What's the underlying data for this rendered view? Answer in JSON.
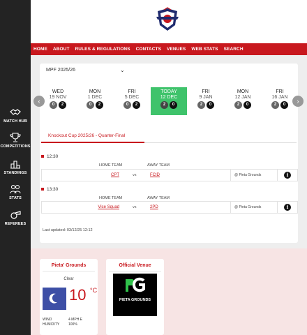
{
  "sidebar": {
    "items": [
      {
        "label": "MATCH HUB",
        "icon": "handshake-icon"
      },
      {
        "label": "COMPETITIONS",
        "icon": "trophy-icon"
      },
      {
        "label": "STANDINGS",
        "icon": "standings-icon"
      },
      {
        "label": "STATS",
        "icon": "stats-icon"
      },
      {
        "label": "REFEREES",
        "icon": "whistle-icon"
      }
    ]
  },
  "nav": {
    "items": [
      "HOME",
      "ABOUT",
      "RULES & REGULATIONS",
      "CONTACTS",
      "VENUES",
      "WEB STATS",
      "SEARCH"
    ]
  },
  "season": {
    "selected": "MPF 2025/26"
  },
  "days": [
    {
      "name": "WED",
      "date": "19 NOV",
      "a": "0",
      "b": "2",
      "active": false
    },
    {
      "name": "MON",
      "date": "1 DEC",
      "a": "0",
      "b": "2",
      "active": false
    },
    {
      "name": "FRI",
      "date": "5 DEC",
      "a": "0",
      "b": "2",
      "active": false
    },
    {
      "name": "TODAY",
      "date": "12 DEC",
      "a": "2",
      "b": "0",
      "active": true
    },
    {
      "name": "FRI",
      "date": "9 JAN",
      "a": "2",
      "b": "0",
      "active": false
    },
    {
      "name": "MON",
      "date": "12 JAN",
      "a": "2",
      "b": "0",
      "active": false
    },
    {
      "name": "FRI",
      "date": "16 JAN",
      "a": "2",
      "b": "0",
      "active": false
    }
  ],
  "competition": {
    "title": "Knockout Cup 2025/26 - Quarter-Final"
  },
  "headers": {
    "home": "HOME TEAM",
    "away": "AWAY TEAM",
    "vs": "vs"
  },
  "matches": [
    {
      "time": "12:30",
      "home": "CPT",
      "away": "FCID",
      "venue": "@ Pieta Grounds"
    },
    {
      "time": "13:30",
      "home": "Vice Squad",
      "away": "2PD",
      "venue": "@ Pieta Grounds"
    }
  ],
  "last_updated": "Last updated: 03/12/25 12:12",
  "weather": {
    "title": "Pieta' Grounds",
    "condition": "Clear",
    "temp": "10",
    "unit": "°C",
    "wind_label": "WIND",
    "wind_value": "4 MPH E",
    "humidity_label": "HUMIDITY",
    "humidity_value": "100%"
  },
  "venue": {
    "title": "Official Venue",
    "logo_text": "PIETA GROUNDS"
  },
  "colors": {
    "brand_red": "#c8181e",
    "active_green": "#3fc36b",
    "sidebar": "#232323"
  }
}
